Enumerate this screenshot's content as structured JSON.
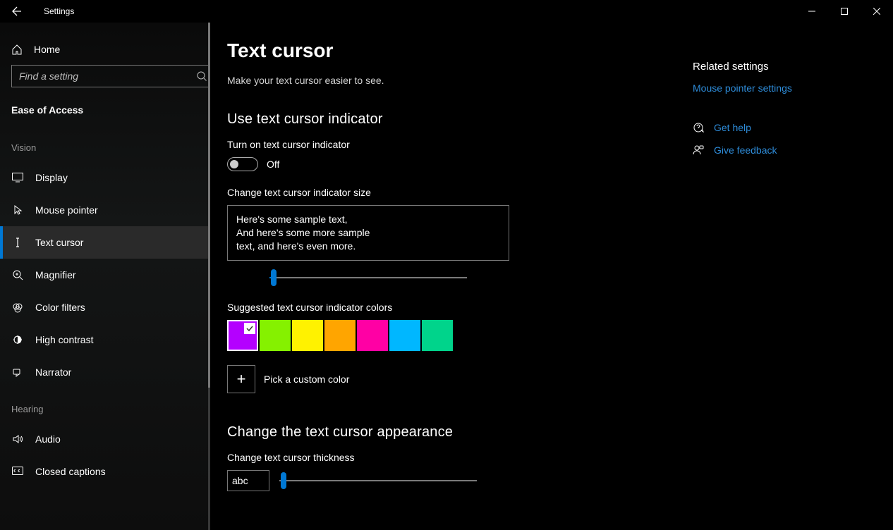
{
  "window": {
    "title": "Settings"
  },
  "sidebar": {
    "home_label": "Home",
    "search_placeholder": "Find a setting",
    "category": "Ease of Access",
    "groups": [
      {
        "label": "Vision",
        "items": [
          {
            "label": "Display",
            "icon": "display-icon",
            "active": false
          },
          {
            "label": "Mouse pointer",
            "icon": "mouse-pointer-icon",
            "active": false
          },
          {
            "label": "Text cursor",
            "icon": "text-cursor-icon",
            "active": true
          },
          {
            "label": "Magnifier",
            "icon": "magnifier-icon",
            "active": false
          },
          {
            "label": "Color filters",
            "icon": "color-filters-icon",
            "active": false
          },
          {
            "label": "High contrast",
            "icon": "high-contrast-icon",
            "active": false
          },
          {
            "label": "Narrator",
            "icon": "narrator-icon",
            "active": false
          }
        ]
      },
      {
        "label": "Hearing",
        "items": [
          {
            "label": "Audio",
            "icon": "audio-icon",
            "active": false
          },
          {
            "label": "Closed captions",
            "icon": "closed-captions-icon",
            "active": false
          }
        ]
      }
    ]
  },
  "main": {
    "title": "Text cursor",
    "subtitle": "Make your text cursor easier to see.",
    "section1": {
      "heading": "Use text cursor indicator",
      "toggle_label": "Turn on text cursor indicator",
      "toggle_state": "Off",
      "size_label": "Change text cursor indicator size",
      "sample": {
        "line1": "Here's some sample text,",
        "line2": "And here's some more sample",
        "line3": "text, and here's even more."
      },
      "colors_label": "Suggested text cursor indicator colors",
      "colors": [
        {
          "hex": "#b400ff",
          "selected": true
        },
        {
          "hex": "#85f100",
          "selected": false
        },
        {
          "hex": "#fff200",
          "selected": false
        },
        {
          "hex": "#ffa500",
          "selected": false
        },
        {
          "hex": "#ff00a4",
          "selected": false
        },
        {
          "hex": "#00b7ff",
          "selected": false
        },
        {
          "hex": "#00d48b",
          "selected": false
        }
      ],
      "custom_color_label": "Pick a custom color"
    },
    "section2": {
      "heading": "Change the text cursor appearance",
      "thickness_label": "Change text cursor thickness",
      "preview_text": "abc"
    }
  },
  "aside": {
    "related_heading": "Related settings",
    "related_link": "Mouse pointer settings",
    "help_link": "Get help",
    "feedback_link": "Give feedback"
  }
}
